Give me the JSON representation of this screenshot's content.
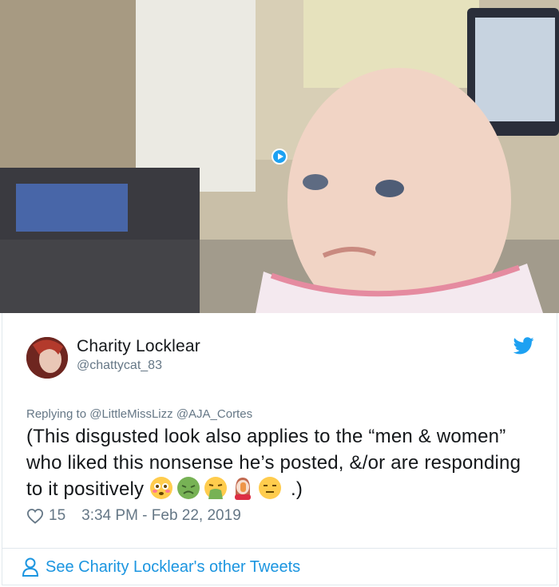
{
  "media": {
    "type": "gif",
    "icon": "play-icon"
  },
  "tweet": {
    "author_name": "Charity Locklear",
    "author_handle": "@chattycat_83",
    "replying_prefix": "Replying to",
    "reply_to": [
      "@LittleMissLizz",
      "@AJA_Cortes"
    ],
    "text": "(This disgusted look also applies to the “men & women” who liked this nonsense he’s posted, &/or are responding to it positively",
    "emoji_list": [
      "flushed-face",
      "nauseated-face",
      "vomiting-face",
      "woman-facepalming",
      "expressionless-face"
    ],
    "text_end": ".)",
    "likes": "15",
    "timestamp": "3:34 PM - Feb 22, 2019"
  },
  "footer": {
    "link_label": "See Charity Locklear's other Tweets"
  },
  "colors": {
    "accent": "#1da1f2",
    "link": "#1b95e0",
    "muted": "#657786",
    "text": "#14171a"
  }
}
